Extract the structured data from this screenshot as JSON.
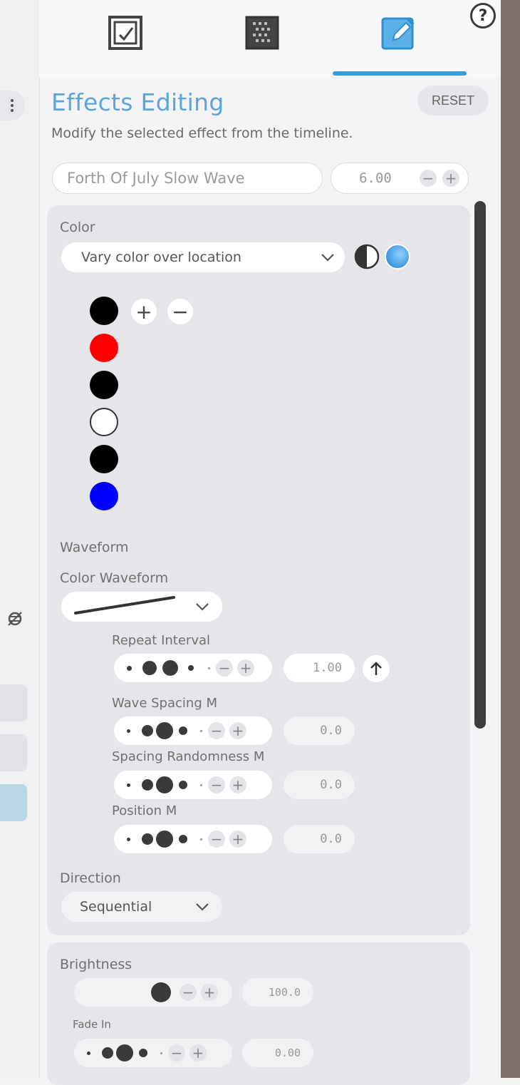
{
  "header": {
    "tabs": [
      {
        "icon": "timeline-edit-icon"
      },
      {
        "icon": "pattern-grid-icon"
      },
      {
        "icon": "edit-pencil-icon",
        "active": true
      }
    ],
    "help_label": "?",
    "accent_color": "#3a9ad9"
  },
  "editor": {
    "title": "Effects Editing",
    "reset_label": "RESET",
    "subtitle": "Modify the selected effect from the timeline.",
    "effect_name": "Forth Of July Slow Wave",
    "duration": "6.00"
  },
  "color": {
    "label": "Color",
    "mode": "Vary color over location",
    "swatches": [
      "#000000",
      "#ff0000",
      "#000000",
      "#ffffff",
      "#000000",
      "#0000ff"
    ]
  },
  "waveform": {
    "label": "Waveform",
    "color_waveform_label": "Color Waveform",
    "params": [
      {
        "label": "Repeat Interval",
        "value": "1.00"
      },
      {
        "label": "Wave Spacing M",
        "value": "0.0"
      },
      {
        "label": "Spacing Randomness M",
        "value": "0.0"
      },
      {
        "label": "Position M",
        "value": "0.0"
      }
    ]
  },
  "direction": {
    "label": "Direction",
    "value": "Sequential"
  },
  "brightness": {
    "label": "Brightness",
    "value": "100.0",
    "fade_in_label": "Fade In",
    "fade_in_value": "0.00"
  }
}
